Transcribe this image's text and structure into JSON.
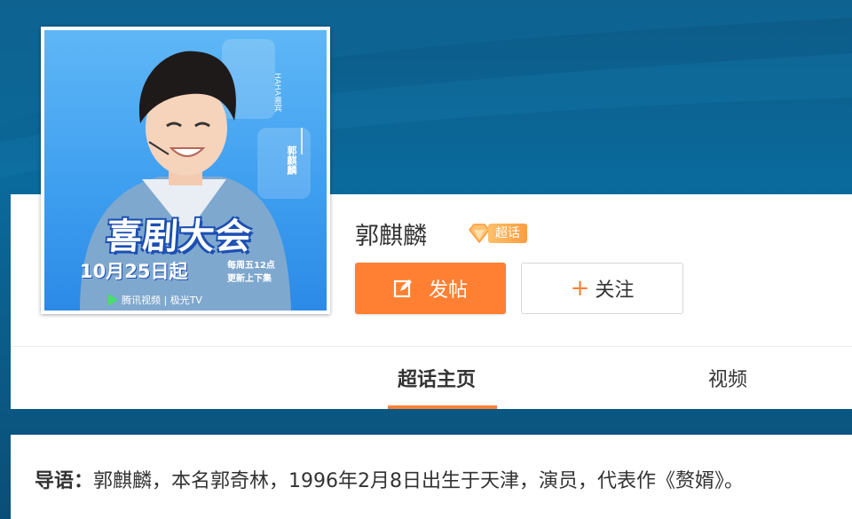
{
  "poster": {
    "title": "喜剧大会",
    "date": "10月25日起",
    "schedule_line1": "每周五12点",
    "schedule_line2": "更新上下集",
    "platform1": "腾讯视频",
    "platform2": "极光TV",
    "side_text": "HAHA嘉宾",
    "side_name": "郭麒麟"
  },
  "profile": {
    "name": "郭麒麟",
    "badge": "超话"
  },
  "actions": {
    "post_label": "发帖",
    "follow_label": "关注",
    "follow_plus": "+"
  },
  "tabs": [
    {
      "label": "超话主页",
      "active": true
    },
    {
      "label": "视频",
      "active": false
    }
  ],
  "intro": {
    "label": "导语：",
    "text": "郭麒麟，本名郭奇林，1996年2月8日出生于天津，演员，代表作《赘婿》。"
  },
  "colors": {
    "accent": "#ff8033",
    "background": "#0b5f8c",
    "poster": "#3f9ff0"
  }
}
